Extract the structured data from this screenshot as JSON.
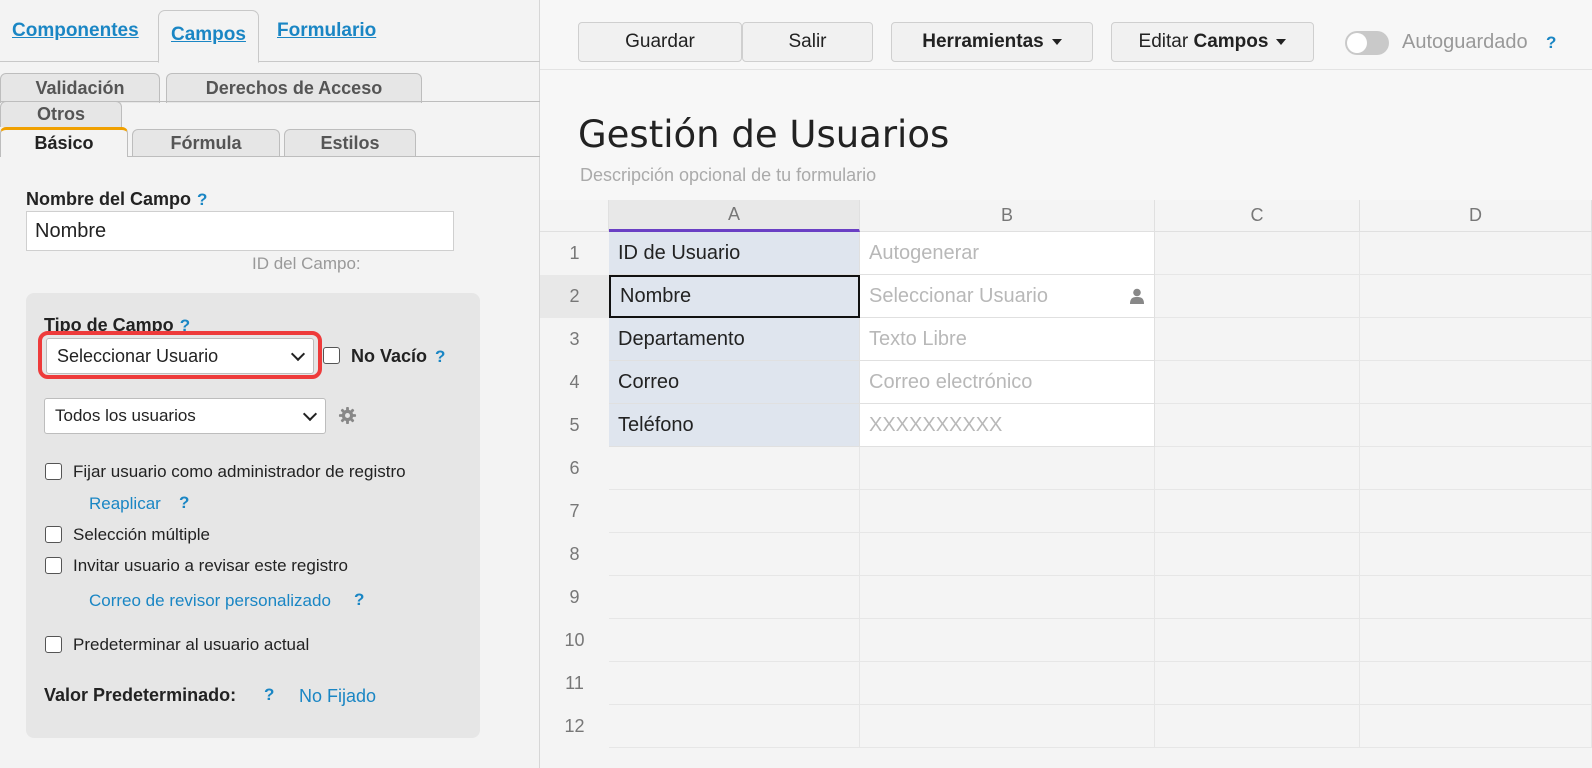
{
  "left_panel": {
    "top_tabs": [
      "Componentes",
      "Campos",
      "Formulario"
    ],
    "sub_tabs_row1": [
      "Validación",
      "Derechos de Acceso",
      "Otros"
    ],
    "sub_tabs_row2": [
      "Básico",
      "Fórmula",
      "Estilos"
    ],
    "field_name_label": "Nombre del Campo",
    "field_name_value": "Nombre",
    "field_id_label": "ID del Campo:",
    "field_type_label": "Tipo de Campo",
    "field_type_value": "Seleccionar Usuario",
    "not_empty_label": "No Vacío",
    "users_select_value": "Todos los usuarios",
    "help_mark": "?",
    "options": [
      "Fijar usuario como administrador de registro",
      "Selección múltiple",
      "Invitar usuario a revisar este registro",
      "Predeterminar al usuario actual"
    ],
    "reapply_link": "Reaplicar",
    "reviewer_email_link": "Correo de revisor personalizado",
    "default_value_label": "Valor Predeterminado:",
    "default_value": "No Fijado"
  },
  "toolbar": {
    "save": "Guardar",
    "exit": "Salir",
    "tools": "Herramientas",
    "edit_prefix": "Editar",
    "edit_bold": "Campos",
    "autosave": "Autoguardado"
  },
  "form": {
    "title": "Gestión de Usuarios",
    "description": "Descripción opcional de tu formulario"
  },
  "grid": {
    "columns": [
      "A",
      "B",
      "C",
      "D"
    ],
    "rows": [
      "1",
      "2",
      "3",
      "4",
      "5",
      "6",
      "7",
      "8",
      "9",
      "10",
      "11",
      "12"
    ],
    "col_a": [
      "ID de Usuario",
      "Nombre",
      "Departamento",
      "Correo",
      "Teléfono"
    ],
    "col_b": [
      "Autogenerar",
      "Seleccionar Usuario",
      "Texto Libre",
      "Correo electrónico",
      "XXXXXXXXXX"
    ]
  },
  "colors": {
    "link": "#1a86c4",
    "highlight": "#ee3b3b",
    "active_tab_accent": "#f0a000",
    "column_select": "#6a3fc4"
  }
}
